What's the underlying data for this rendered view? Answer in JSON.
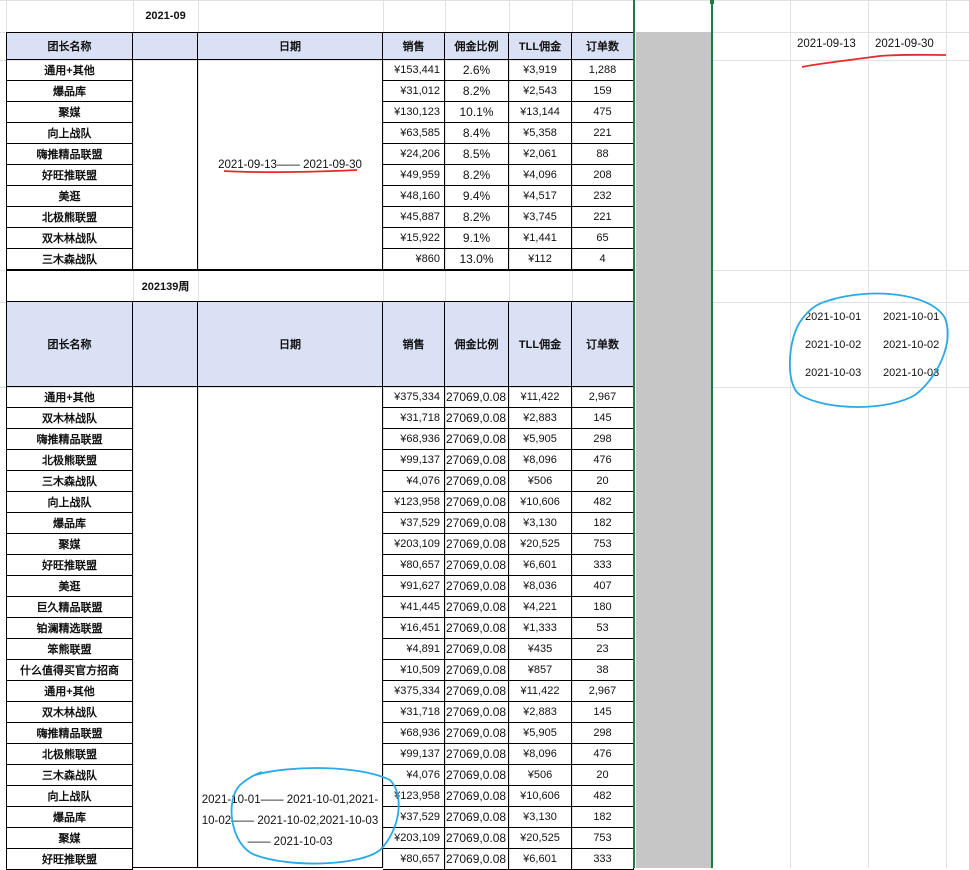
{
  "sheet": {
    "section1": {
      "title": "2021-09",
      "headers": [
        "团长名称",
        "",
        "日期",
        "销售",
        "佣金比例",
        "TLL佣金",
        "订单数"
      ],
      "date_range": "2021-09-13—— 2021-09-30",
      "rows": [
        [
          "通用+其他",
          "¥153,441",
          "2.6%",
          "¥3,919",
          "1,288"
        ],
        [
          "爆品库",
          "¥31,012",
          "8.2%",
          "¥2,543",
          "159"
        ],
        [
          "聚媒",
          "¥130,123",
          "10.1%",
          "¥13,144",
          "475"
        ],
        [
          "向上战队",
          "¥63,585",
          "8.4%",
          "¥5,358",
          "221"
        ],
        [
          "嗨推精品联盟",
          "¥24,206",
          "8.5%",
          "¥2,061",
          "88"
        ],
        [
          "好旺推联盟",
          "¥49,959",
          "8.2%",
          "¥4,096",
          "208"
        ],
        [
          "美逛",
          "¥48,160",
          "9.4%",
          "¥4,517",
          "232"
        ],
        [
          "北极熊联盟",
          "¥45,887",
          "8.2%",
          "¥3,745",
          "221"
        ],
        [
          "双木林战队",
          "¥15,922",
          "9.1%",
          "¥1,441",
          "65"
        ],
        [
          "三木森战队",
          "¥860",
          "13.0%",
          "¥112",
          "4"
        ]
      ]
    },
    "section2": {
      "title": "202139周",
      "headers": [
        "团长名称",
        "",
        "日期",
        "销售",
        "佣金比例",
        "TLL佣金",
        "订单数"
      ],
      "date_lines": [
        "2021-10-01—— 2021-10-01,2021-",
        "10-02—— 2021-10-02,2021-10-03",
        "—— 2021-10-03"
      ],
      "rows": [
        [
          "通用+其他",
          "¥375,334",
          "27069,0.08",
          "¥11,422",
          "2,967"
        ],
        [
          "双木林战队",
          "¥31,718",
          "27069,0.08",
          "¥2,883",
          "145"
        ],
        [
          "嗨推精品联盟",
          "¥68,936",
          "27069,0.08",
          "¥5,905",
          "298"
        ],
        [
          "北极熊联盟",
          "¥99,137",
          "27069,0.08",
          "¥8,096",
          "476"
        ],
        [
          "三木森战队",
          "¥4,076",
          "27069,0.08",
          "¥506",
          "20"
        ],
        [
          "向上战队",
          "¥123,958",
          "27069,0.08",
          "¥10,606",
          "482"
        ],
        [
          "爆品库",
          "¥37,529",
          "27069,0.08",
          "¥3,130",
          "182"
        ],
        [
          "聚媒",
          "¥203,109",
          "27069,0.08",
          "¥20,525",
          "753"
        ],
        [
          "好旺推联盟",
          "¥80,657",
          "27069,0.08",
          "¥6,601",
          "333"
        ],
        [
          "美逛",
          "¥91,627",
          "27069,0.08",
          "¥8,036",
          "407"
        ],
        [
          "巨久精品联盟",
          "¥41,445",
          "27069,0.08",
          "¥4,221",
          "180"
        ],
        [
          "铂澜精选联盟",
          "¥16,451",
          "27069,0.08",
          "¥1,333",
          "53"
        ],
        [
          "笨熊联盟",
          "¥4,891",
          "27069,0.08",
          "¥435",
          "23"
        ],
        [
          "什么值得买官方招商",
          "¥10,509",
          "27069,0.08",
          "¥857",
          "38"
        ],
        [
          "通用+其他",
          "¥375,334",
          "27069,0.08",
          "¥11,422",
          "2,967"
        ],
        [
          "双木林战队",
          "¥31,718",
          "27069,0.08",
          "¥2,883",
          "145"
        ],
        [
          "嗨推精品联盟",
          "¥68,936",
          "27069,0.08",
          "¥5,905",
          "298"
        ],
        [
          "北极熊联盟",
          "¥99,137",
          "27069,0.08",
          "¥8,096",
          "476"
        ],
        [
          "三木森战队",
          "¥4,076",
          "27069,0.08",
          "¥506",
          "20"
        ],
        [
          "向上战队",
          "¥123,958",
          "27069,0.08",
          "¥10,606",
          "482"
        ],
        [
          "爆品库",
          "¥37,529",
          "27069,0.08",
          "¥3,130",
          "182"
        ],
        [
          "聚媒",
          "¥203,109",
          "27069,0.08",
          "¥20,525",
          "753"
        ],
        [
          "好旺推联盟",
          "¥80,657",
          "27069,0.08",
          "¥6,601",
          "333"
        ]
      ]
    },
    "side": {
      "range1": [
        "2021-09-13",
        "2021-09-30"
      ],
      "range2": [
        [
          "2021-10-01",
          "2021-10-01"
        ],
        [
          "2021-10-02",
          "2021-10-02"
        ],
        [
          "2021-10-03",
          "2021-10-03"
        ]
      ]
    },
    "colors": {
      "header_bg": "#dae1f5",
      "gray_band": "#c6c6c6",
      "frame_green": "#1e7b45",
      "annotation_red": "#e52b2b",
      "annotation_blue": "#2aa9e8"
    }
  }
}
